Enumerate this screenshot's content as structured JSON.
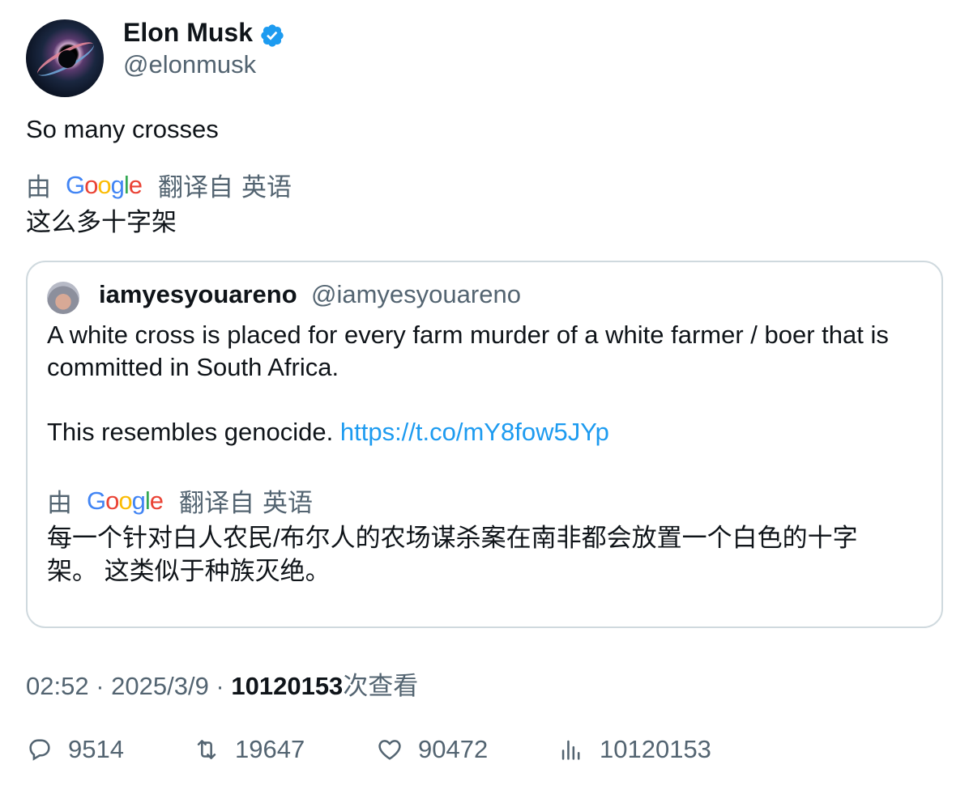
{
  "author": {
    "name": "Elon Musk",
    "handle": "@elonmusk",
    "verified_icon": "verified-badge-icon"
  },
  "tweet": {
    "text": "So many crosses",
    "translation_by": "由",
    "translation_brand": "Google",
    "translation_from": "翻译自",
    "translation_lang": "英语",
    "translated_text": "这么多十字架"
  },
  "quote": {
    "name": "iamyesyouareno",
    "handle": "@iamyesyouareno",
    "line1": "A white cross is placed for every farm murder of a white farmer / boer that is committed in South Africa.",
    "line2": "This resembles genocide.",
    "link": "https://t.co/mY8fow5JYp",
    "translation_by": "由",
    "translation_brand": "Google",
    "translation_from": "翻译自",
    "translation_lang": "英语",
    "translated_text": "每一个针对白人农民/布尔人的农场谋杀案在南非都会放置一个白色的十字架。 这类似于种族灭绝。"
  },
  "meta": {
    "time": "02:52",
    "sep1": " · ",
    "date": "2025/3/9",
    "sep2": " · ",
    "views": "10120153",
    "views_label": "次查看"
  },
  "actions": {
    "replies": "9514",
    "retweets": "19647",
    "likes": "90472",
    "views": "10120153"
  },
  "colors": {
    "accent": "#1d9bf0",
    "secondary_text": "#536471",
    "border": "#cfd9de"
  }
}
